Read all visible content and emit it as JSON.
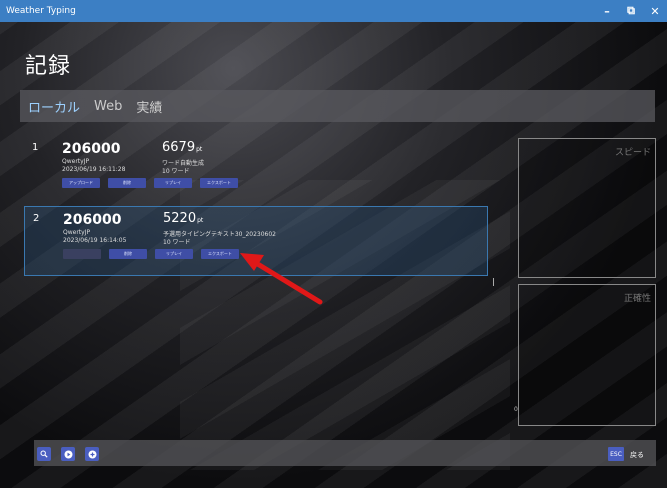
{
  "window": {
    "title": "Weather Typing",
    "minimize": "–",
    "restore": "⧉",
    "close": "✕"
  },
  "page_title": "記録",
  "tabs": [
    {
      "label": "ローカル",
      "active": true
    },
    {
      "label": "Web",
      "active": false
    },
    {
      "label": "実績",
      "active": false
    }
  ],
  "records": [
    {
      "rank": "1",
      "score": "206000",
      "user": "QwertyJP",
      "date": "2023/06/19 16:11:28",
      "speed": "6679",
      "speed_unit": "pt",
      "text_name": "ワード自動生成",
      "words": "10 ワード",
      "buttons": [
        "アップロード",
        "削除",
        "リプレイ",
        "エクスポート"
      ]
    },
    {
      "rank": "2",
      "score": "206000",
      "user": "QwertyJP",
      "date": "2023/06/19 16:14:05",
      "speed": "5220",
      "speed_unit": "pt",
      "text_name": "予選用タイピングテキスト30_20230602",
      "words": "10 ワード",
      "buttons": [
        "",
        "削除",
        "リプレイ",
        "エクスポート"
      ]
    }
  ],
  "side": {
    "speed_label": "スピード",
    "accuracy_label": "正確性",
    "zero": "0"
  },
  "bottom": {
    "esc": "ESC",
    "back": "戻る"
  },
  "icons": [
    "search-icon",
    "play-circle-icon",
    "plus-circle-icon"
  ],
  "colors": {
    "titlebar": "#3c7fc4",
    "button": "#3f4ea6",
    "annotation_arrow": "#e01818"
  }
}
